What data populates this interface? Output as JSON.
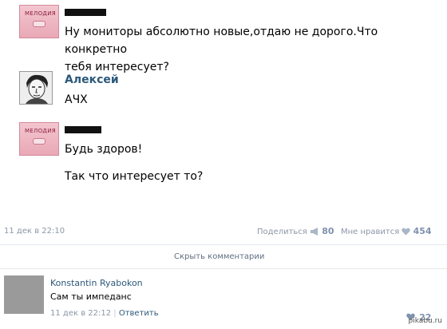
{
  "messages": [
    {
      "name": "",
      "lines": [
        "Ну мониторы абсолютно новые,отдаю не дорого.Что конкретно",
        "тебя интересует?"
      ]
    },
    {
      "name": "Алексей",
      "lines": [
        "АЧХ"
      ]
    },
    {
      "name": "",
      "lines": [
        "Будь здоров!",
        "Так что интересует то?"
      ]
    }
  ],
  "avatar_text": "МЕЛОДИЯ",
  "post_footer": {
    "timestamp": "11 дек в 22:10",
    "share_label": "Поделиться",
    "share_count": "80",
    "like_label": "Мне нравится",
    "like_count": "454"
  },
  "hide_comments_label": "Скрыть комментарии",
  "comment": {
    "author": "Konstantin Ryabokon",
    "text": "Сам ты импеданс",
    "timestamp": "11 дек в 22:12",
    "separator": "|",
    "reply_label": "Ответить",
    "like_count": "22"
  },
  "watermark": "pikabu.ru",
  "colors": {
    "link": "#2b587a",
    "meta": "#8b97a6",
    "avatar_pink": "#e9a8b6"
  }
}
